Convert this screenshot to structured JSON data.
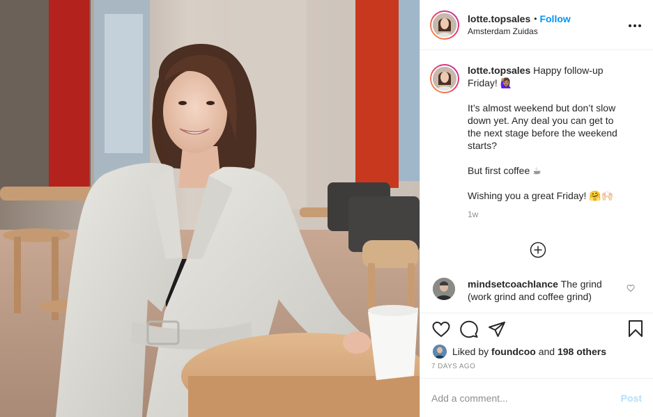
{
  "post": {
    "username": "lotte.topsales",
    "follow_label": "Follow",
    "separator": "•",
    "location": "Amsterdam Zuidas",
    "more_label": "•••"
  },
  "caption": {
    "username": "lotte.topsales",
    "line1": "Happy follow-up Friday! 🙋🏽‍♀️",
    "para2": "It’s almost weekend but don’t slow down yet. Any deal you can get to the next stage before the weekend starts?",
    "para3": "But first coffee ☕",
    "para4": "Wishing you a great Friday! 🤗🙌🏻",
    "time": "1w"
  },
  "comments": [
    {
      "username": "mindsetcoachlance",
      "text": "The grind (work grind and coffee grind)"
    }
  ],
  "likes": {
    "prefix": "Liked by",
    "user": "foundcoo",
    "middle": "and",
    "others": "198 others"
  },
  "date": "7 DAYS AGO",
  "add_comment": {
    "placeholder": "Add a comment...",
    "post_label": "Post"
  },
  "colors": {
    "accent": "#0095f6",
    "post_disabled": "#b2dffc",
    "muted": "#8e8e8e",
    "border": "#efefef"
  }
}
